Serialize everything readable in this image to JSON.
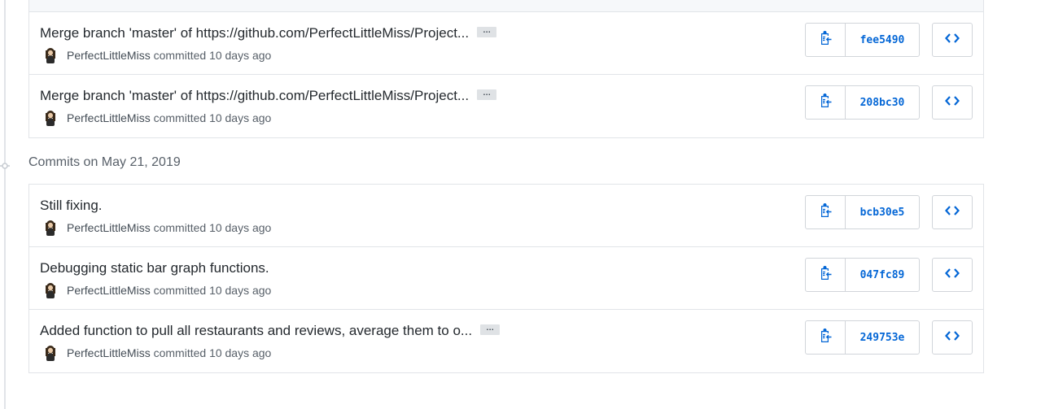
{
  "groups": [
    {
      "date_header": "",
      "commits": [
        {
          "title": "Merge branch 'master' of https://github.com/PerfectLittleMiss/Project...",
          "has_ellipsis": true,
          "author": "PerfectLittleMiss",
          "committed_text": "committed",
          "time": "10 days ago",
          "sha": "fee5490"
        },
        {
          "title": "Merge branch 'master' of https://github.com/PerfectLittleMiss/Project...",
          "has_ellipsis": true,
          "author": "PerfectLittleMiss",
          "committed_text": "committed",
          "time": "10 days ago",
          "sha": "208bc30"
        }
      ]
    },
    {
      "date_header": "Commits on May 21, 2019",
      "commits": [
        {
          "title": "Still fixing.",
          "has_ellipsis": false,
          "author": "PerfectLittleMiss",
          "committed_text": "committed",
          "time": "10 days ago",
          "sha": "bcb30e5"
        },
        {
          "title": "Debugging static bar graph functions.",
          "has_ellipsis": false,
          "author": "PerfectLittleMiss",
          "committed_text": "committed",
          "time": "10 days ago",
          "sha": "047fc89"
        },
        {
          "title": "Added function to pull all restaurants and reviews, average them to o...",
          "has_ellipsis": true,
          "author": "PerfectLittleMiss",
          "committed_text": "committed",
          "time": "10 days ago",
          "sha": "249753e"
        }
      ]
    }
  ],
  "ellipsis_label": "…",
  "icons": {
    "copy": "clippy-icon",
    "browse": "code-icon",
    "timeline": "git-commit-icon",
    "avatar": "avatar"
  },
  "colors": {
    "link": "#0366d6",
    "border": "#e1e4e8",
    "muted": "#586069"
  }
}
